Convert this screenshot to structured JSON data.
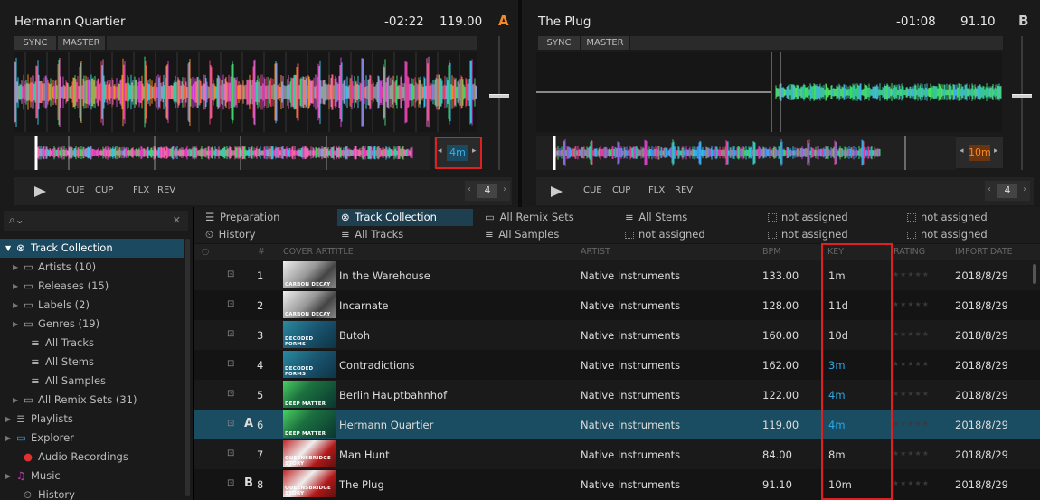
{
  "colors": {
    "deck_a_letter": "#f08a2a",
    "deck_b_letter": "#cccccc",
    "selection": "#1b4d62",
    "key_highlight": "#2ea8e8",
    "highlight_box": "#e02020",
    "loop_b_active": "#f08a2a"
  },
  "deckA": {
    "title": "Hermann Quartier",
    "time": "-02:22",
    "bpm": "119.00",
    "letter": "A",
    "sync": "SYNC",
    "master": "MASTER",
    "cue": "CUE",
    "cup": "CUP",
    "flx": "FLX",
    "rev": "REV",
    "loop_size": "4",
    "mini_loop": "4m"
  },
  "deckB": {
    "title": "The Plug",
    "time": "-01:08",
    "bpm": "91.10",
    "letter": "B",
    "sync": "SYNC",
    "master": "MASTER",
    "cue": "CUE",
    "cup": "CUP",
    "flx": "FLX",
    "rev": "REV",
    "loop_size": "4",
    "mini_loop": "10m"
  },
  "search": {
    "placeholder": ""
  },
  "tree": [
    {
      "label": "Track Collection",
      "icon": "collection-icon",
      "selected": true
    },
    {
      "label": "Artists (10)",
      "icon": "folder-icon"
    },
    {
      "label": "Releases (15)",
      "icon": "folder-icon"
    },
    {
      "label": "Labels (2)",
      "icon": "folder-icon"
    },
    {
      "label": "Genres (19)",
      "icon": "folder-icon"
    },
    {
      "label": "All Tracks",
      "icon": "list-icon"
    },
    {
      "label": "All Stems",
      "icon": "list-icon"
    },
    {
      "label": "All Samples",
      "icon": "list-icon"
    },
    {
      "label": "All Remix Sets (31)",
      "icon": "folder-icon"
    },
    {
      "label": "Playlists",
      "icon": "playlist-icon"
    },
    {
      "label": "Explorer",
      "icon": "explorer-icon"
    },
    {
      "label": "Audio Recordings",
      "icon": "record-icon"
    },
    {
      "label": "Music",
      "icon": "music-icon"
    },
    {
      "label": "History",
      "icon": "history-icon"
    }
  ],
  "favorites": [
    {
      "label": "Preparation",
      "icon": "preparation-icon"
    },
    {
      "label": "Track Collection",
      "icon": "collection-icon",
      "selected": true
    },
    {
      "label": "All Remix Sets",
      "icon": "folder-icon"
    },
    {
      "label": "All Stems",
      "icon": "list-icon"
    },
    {
      "label": "not assigned",
      "icon": "dotbox-icon"
    },
    {
      "label": "not assigned",
      "icon": "dotbox-icon"
    },
    {
      "label": "History",
      "icon": "history-icon"
    },
    {
      "label": "All Tracks",
      "icon": "list-icon"
    },
    {
      "label": "All Samples",
      "icon": "list-icon"
    },
    {
      "label": "not assigned",
      "icon": "dotbox-icon"
    },
    {
      "label": "not assigned",
      "icon": "dotbox-icon"
    },
    {
      "label": "not assigned",
      "icon": "dotbox-icon"
    }
  ],
  "columns": {
    "num": "#",
    "cover": "COVER ART",
    "title": "TITLE",
    "artist": "ARTIST",
    "bpm": "BPM",
    "key": "KEY",
    "rating": "RATING",
    "import": "IMPORT DATE"
  },
  "tracks": [
    {
      "deck": "",
      "num": "1",
      "title": "In the Warehouse",
      "artist": "Native Instruments",
      "bpm": "133.00",
      "key": "1m",
      "key_hl": false,
      "rating": 0,
      "date": "2018/8/29",
      "cover": "CARBON DECAY"
    },
    {
      "deck": "",
      "num": "2",
      "title": "Incarnate",
      "artist": "Native Instruments",
      "bpm": "128.00",
      "key": "11d",
      "key_hl": false,
      "rating": 0,
      "date": "2018/8/29",
      "cover": "CARBON DECAY"
    },
    {
      "deck": "",
      "num": "3",
      "title": "Butoh",
      "artist": "Native Instruments",
      "bpm": "160.00",
      "key": "10d",
      "key_hl": false,
      "rating": 0,
      "date": "2018/8/29",
      "cover": "DECODED FORMS"
    },
    {
      "deck": "",
      "num": "4",
      "title": "Contradictions",
      "artist": "Native Instruments",
      "bpm": "162.00",
      "key": "3m",
      "key_hl": true,
      "rating": 0,
      "date": "2018/8/29",
      "cover": "DECODED FORMS"
    },
    {
      "deck": "",
      "num": "5",
      "title": "Berlin Hauptbahnhof",
      "artist": "Native Instruments",
      "bpm": "122.00",
      "key": "4m",
      "key_hl": true,
      "rating": 0,
      "date": "2018/8/29",
      "cover": "DEEP MATTER"
    },
    {
      "deck": "A",
      "num": "6",
      "title": "Hermann Quartier",
      "artist": "Native Instruments",
      "bpm": "119.00",
      "key": "4m",
      "key_hl": true,
      "rating": 0,
      "date": "2018/8/29",
      "cover": "DEEP MATTER",
      "selected": true
    },
    {
      "deck": "",
      "num": "7",
      "title": "Man Hunt",
      "artist": "Native Instruments",
      "bpm": "84.00",
      "key": "8m",
      "key_hl": false,
      "rating": 0,
      "date": "2018/8/29",
      "cover": "QUEENSBRIDGE STORY"
    },
    {
      "deck": "B",
      "num": "8",
      "title": "The Plug",
      "artist": "Native Instruments",
      "bpm": "91.10",
      "key": "10m",
      "key_hl": false,
      "rating": 0,
      "date": "2018/8/29",
      "cover": "QUEENSBRIDGE STORY"
    }
  ]
}
